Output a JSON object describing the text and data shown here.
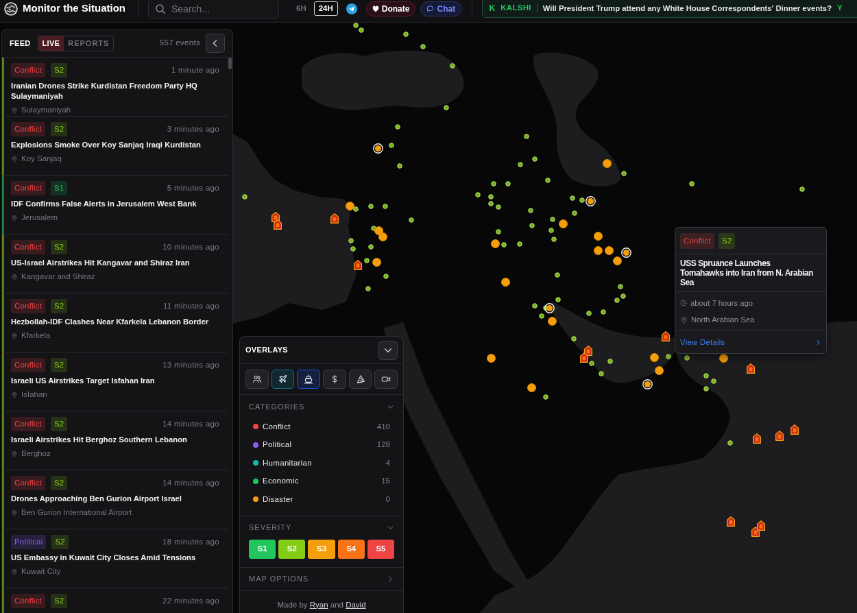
{
  "top_bar": {
    "title": "Monitor the Situation",
    "search": {
      "placeholder": "Search..."
    },
    "time_ranges": [
      {
        "label": "6H",
        "selected": false
      },
      {
        "label": "24H",
        "selected": true
      }
    ],
    "donate_button": "Donate",
    "chat_button": "Chat",
    "ticker": {
      "logo": "K",
      "source": "KALSHI",
      "question": "Will President Trump attend any White House Correspondents' Dinner events?",
      "answer": "Y"
    }
  },
  "feed": {
    "title": "FEED",
    "tabs": [
      {
        "label": "LIVE",
        "selected": true
      },
      {
        "label": "REPORTS",
        "selected": false
      }
    ],
    "count": "557 events",
    "items": [
      {
        "category": {
          "label": "Conflict",
          "kind": "conflict"
        },
        "severity": {
          "label": "S2",
          "kind": "s2"
        },
        "time": "1 minute ago",
        "title": "Iranian Drones Strike Kurdistan Freedom Party HQ Sulaymaniyah",
        "location": "Sulaymaniyah"
      },
      {
        "category": {
          "label": "Conflict",
          "kind": "conflict"
        },
        "severity": {
          "label": "S2",
          "kind": "s2"
        },
        "time": "3 minutes ago",
        "title": "Explosions Smoke Over Koy Sanjaq Iraqi Kurdistan",
        "location": "Koy Sanjaq"
      },
      {
        "category": {
          "label": "Conflict",
          "kind": "conflict"
        },
        "severity": {
          "label": "S1",
          "kind": "s1"
        },
        "time": "5 minutes ago",
        "title": "IDF Confirms False Alerts in Jerusalem West Bank",
        "location": "Jerusalem"
      },
      {
        "category": {
          "label": "Conflict",
          "kind": "conflict"
        },
        "severity": {
          "label": "S2",
          "kind": "s2"
        },
        "time": "10 minutes ago",
        "title": "US-Israel Airstrikes Hit Kangavar and Shiraz Iran",
        "location": "Kangavar and Shiraz"
      },
      {
        "category": {
          "label": "Conflict",
          "kind": "conflict"
        },
        "severity": {
          "label": "S2",
          "kind": "s2"
        },
        "time": "11 minutes ago",
        "title": "Hezbollah-IDF Clashes Near Kfarkela Lebanon Border",
        "location": "Kfarkela"
      },
      {
        "category": {
          "label": "Conflict",
          "kind": "conflict"
        },
        "severity": {
          "label": "S2",
          "kind": "s2"
        },
        "time": "13 minutes ago",
        "title": "Israeli US Airstrikes Target Isfahan Iran",
        "location": "Isfahan"
      },
      {
        "category": {
          "label": "Conflict",
          "kind": "conflict"
        },
        "severity": {
          "label": "S2",
          "kind": "s2"
        },
        "time": "14 minutes ago",
        "title": "Israeli Airstrikes Hit Berghoz Southern Lebanon",
        "location": "Berghoz"
      },
      {
        "category": {
          "label": "Conflict",
          "kind": "conflict"
        },
        "severity": {
          "label": "S2",
          "kind": "s2"
        },
        "time": "14 minutes ago",
        "title": "Drones Approaching Ben Gurion Airport Israel",
        "location": "Ben Gurion International Airport"
      },
      {
        "category": {
          "label": "Political",
          "kind": "political"
        },
        "severity": {
          "label": "S2",
          "kind": "s2"
        },
        "time": "18 minutes ago",
        "title": "US Embassy in Kuwait City Closes Amid Tensions",
        "location": "Kuwait City"
      },
      {
        "category": {
          "label": "Conflict",
          "kind": "conflict"
        },
        "severity": {
          "label": "S2",
          "kind": "s2"
        },
        "time": "22 minutes ago"
      }
    ]
  },
  "overlays": {
    "title": "OVERLAYS",
    "toggles": [
      {
        "kind": "people",
        "on": false
      },
      {
        "kind": "plane",
        "on": true,
        "color": "#0e7490"
      },
      {
        "kind": "ship",
        "on": true,
        "color": "#1d4ed8"
      },
      {
        "kind": "dollar",
        "on": false
      },
      {
        "kind": "wedge",
        "on": false
      },
      {
        "kind": "camera",
        "on": false
      }
    ],
    "categories": {
      "title": "CATEGORIES",
      "items": [
        {
          "label": "Conflict",
          "count": "410",
          "color": "#ef4444"
        },
        {
          "label": "Political",
          "count": "128",
          "color": "#8b5cf6"
        },
        {
          "label": "Humanitarian",
          "count": "4",
          "color": "#14b8a6"
        },
        {
          "label": "Economic",
          "count": "15",
          "color": "#22c55e"
        },
        {
          "label": "Disaster",
          "count": "0",
          "color": "#f59e0b"
        }
      ]
    },
    "severity": {
      "title": "SEVERITY",
      "levels": [
        {
          "label": "S1",
          "color": "#22c55e",
          "selected": true
        },
        {
          "label": "S2",
          "color": "#84cc16",
          "selected": true
        },
        {
          "label": "S3",
          "color": "#f59e0b",
          "selected": true
        },
        {
          "label": "S4",
          "color": "#f97316",
          "selected": true
        },
        {
          "label": "S5",
          "color": "#ef4444",
          "selected": true
        }
      ]
    },
    "map_options": "MAP OPTIONS",
    "credits": {
      "prefix": "Made by",
      "authors": [
        "Ryan",
        "David"
      ],
      "joiner": "and"
    }
  },
  "map": {
    "popup": {
      "category": {
        "label": "Conflict",
        "kind": "conflict"
      },
      "severity": {
        "label": "S2",
        "kind": "s2"
      },
      "title": "USS Spruance Launches Tomahawks into Iran from N. Arabian Sea",
      "time": "about 7 hours ago",
      "location": "North Arabian Sea",
      "link": "View Details"
    },
    "markers": [
      {
        "kind": "dot"
      },
      {
        "kind": "dot"
      },
      {
        "kind": "dot"
      },
      {
        "kind": "dot"
      },
      {
        "kind": "dot"
      },
      {
        "kind": "dot"
      },
      {
        "kind": "dot"
      },
      {
        "kind": "dot"
      },
      {
        "kind": "dot"
      },
      {
        "kind": "dot"
      },
      {
        "kind": "dot"
      },
      {
        "kind": "dot"
      },
      {
        "kind": "dot"
      },
      {
        "kind": "dot"
      },
      {
        "kind": "dot"
      },
      {
        "kind": "dot"
      },
      {
        "kind": "dot"
      },
      {
        "kind": "dot"
      },
      {
        "kind": "dot"
      },
      {
        "kind": "dot"
      },
      {
        "kind": "dot"
      },
      {
        "kind": "dot"
      },
      {
        "kind": "dot"
      },
      {
        "kind": "dot"
      },
      {
        "kind": "dot"
      },
      {
        "kind": "dot"
      },
      {
        "kind": "dot"
      },
      {
        "kind": "dot"
      },
      {
        "kind": "dot"
      },
      {
        "kind": "dot"
      },
      {
        "kind": "dot"
      },
      {
        "kind": "dot"
      },
      {
        "kind": "dot"
      },
      {
        "kind": "dot"
      },
      {
        "kind": "dot"
      },
      {
        "kind": "dot"
      },
      {
        "kind": "dot"
      },
      {
        "kind": "dot"
      },
      {
        "kind": "dot"
      },
      {
        "kind": "dot"
      },
      {
        "kind": "dot"
      },
      {
        "kind": "dot"
      },
      {
        "kind": "dot"
      },
      {
        "kind": "dot"
      },
      {
        "kind": "dot"
      },
      {
        "kind": "dot"
      },
      {
        "kind": "dot"
      },
      {
        "kind": "dot"
      },
      {
        "kind": "dot"
      },
      {
        "kind": "dot"
      },
      {
        "kind": "dot"
      },
      {
        "kind": "dot"
      },
      {
        "kind": "dot"
      },
      {
        "kind": "dot"
      },
      {
        "kind": "dot"
      },
      {
        "kind": "dot"
      },
      {
        "kind": "dot"
      },
      {
        "kind": "dot"
      },
      {
        "kind": "dot"
      },
      {
        "kind": "dot"
      },
      {
        "kind": "dot"
      },
      {
        "kind": "dot"
      },
      {
        "kind": "dot"
      },
      {
        "kind": "dot"
      },
      {
        "kind": "dot"
      },
      {
        "kind": "dot"
      },
      {
        "kind": "circle"
      },
      {
        "kind": "circle"
      },
      {
        "kind": "circle"
      },
      {
        "kind": "circle"
      },
      {
        "kind": "circle"
      },
      {
        "kind": "circle"
      },
      {
        "kind": "circle"
      },
      {
        "kind": "circle"
      },
      {
        "kind": "circle"
      },
      {
        "kind": "circle"
      },
      {
        "kind": "circle"
      },
      {
        "kind": "circle"
      },
      {
        "kind": "circle"
      },
      {
        "kind": "circle"
      },
      {
        "kind": "circle"
      },
      {
        "kind": "circle"
      },
      {
        "kind": "circle"
      },
      {
        "kind": "circle"
      },
      {
        "kind": "flame"
      },
      {
        "kind": "flame"
      },
      {
        "kind": "flame"
      },
      {
        "kind": "flame"
      },
      {
        "kind": "flame"
      },
      {
        "kind": "flame"
      },
      {
        "kind": "flame"
      },
      {
        "kind": "flame"
      },
      {
        "kind": "flame"
      },
      {
        "kind": "flame"
      },
      {
        "kind": "flame"
      },
      {
        "kind": "flame"
      },
      {
        "kind": "flame"
      },
      {
        "kind": "flame"
      },
      {
        "kind": "ring"
      },
      {
        "kind": "ring"
      },
      {
        "kind": "ring"
      },
      {
        "kind": "ring"
      },
      {
        "kind": "ring"
      }
    ]
  }
}
